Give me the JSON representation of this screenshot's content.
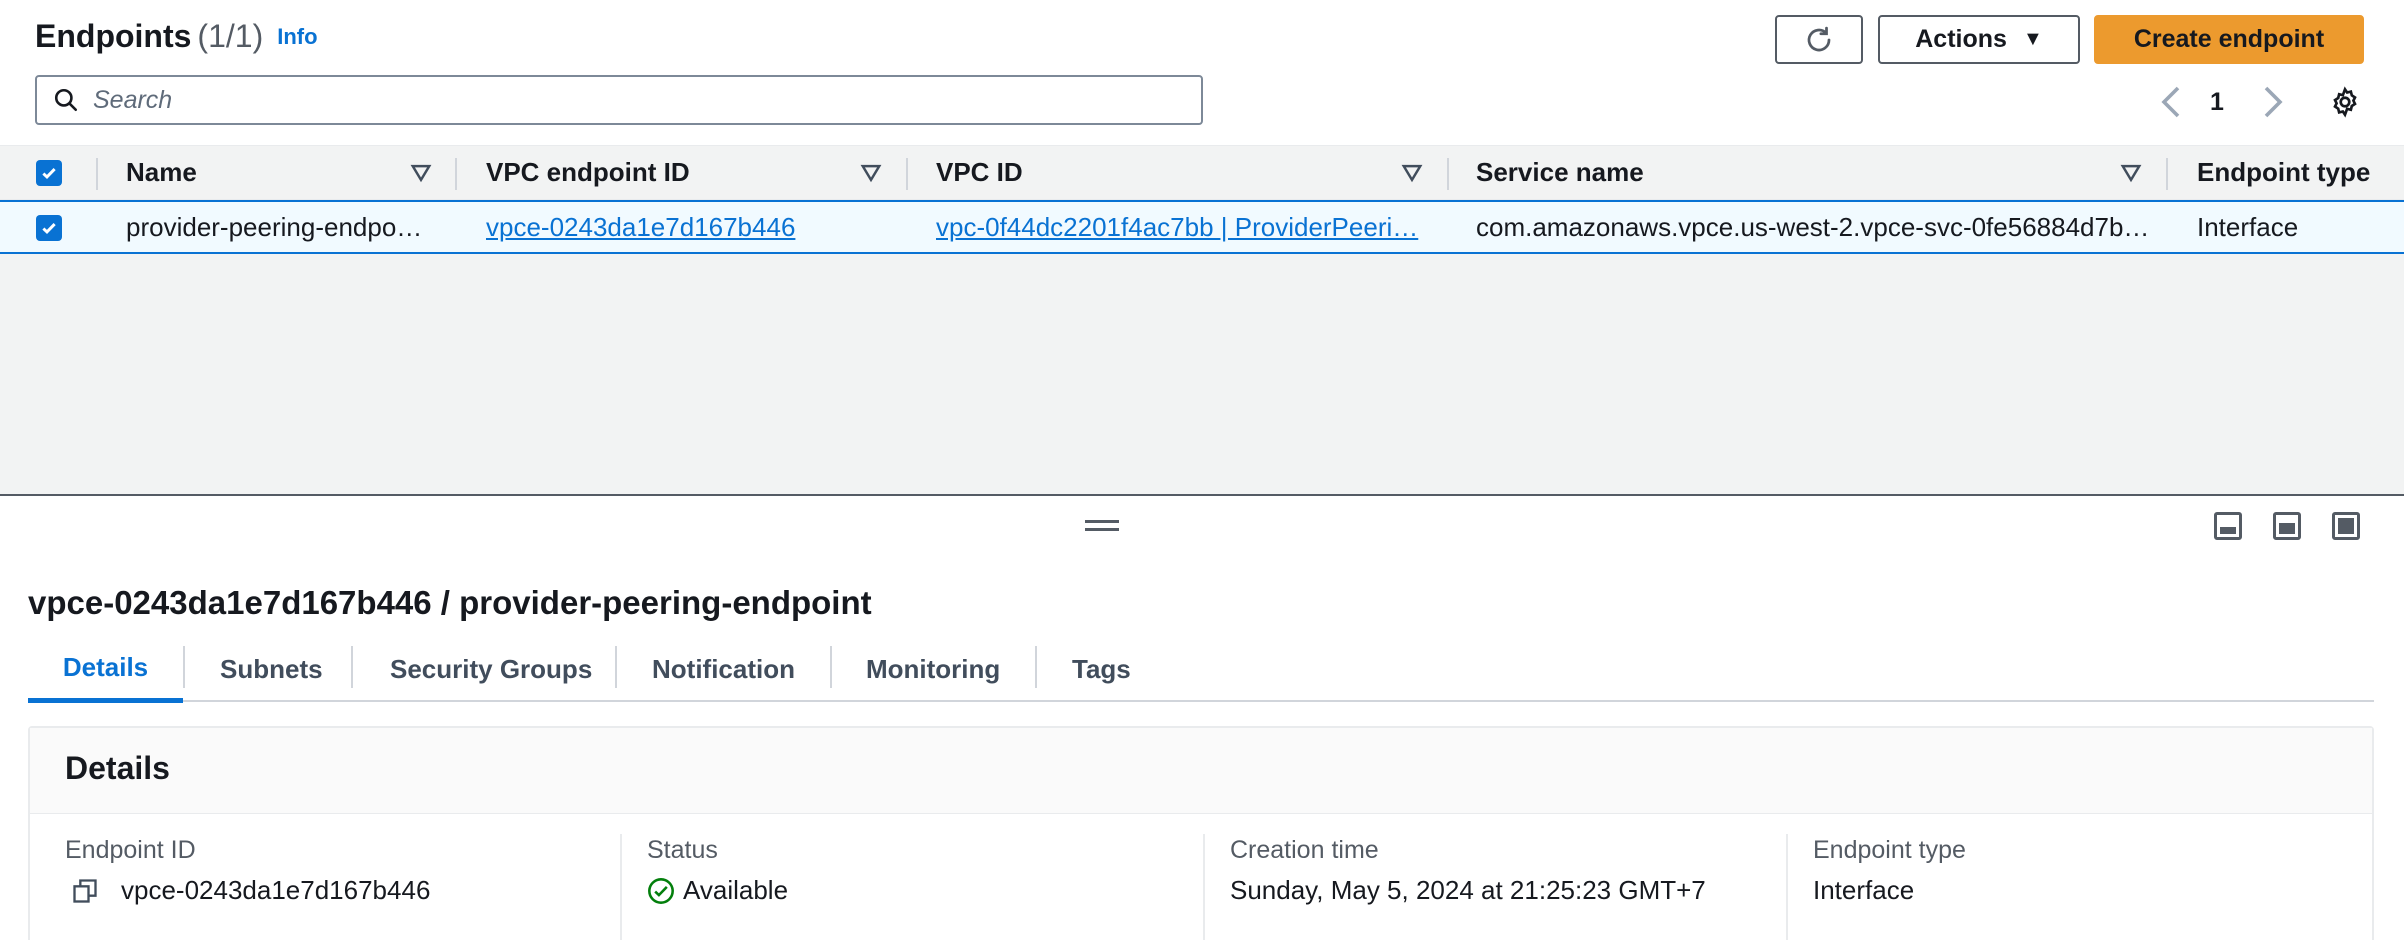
{
  "header": {
    "title": "Endpoints",
    "count": "(1/1)",
    "info": "Info",
    "actions_label": "Actions",
    "create_label": "Create endpoint"
  },
  "search": {
    "placeholder": "Search"
  },
  "pagination": {
    "current_page": "1"
  },
  "table": {
    "columns": [
      "Name",
      "VPC endpoint ID",
      "VPC ID",
      "Service name",
      "Endpoint type"
    ],
    "rows": [
      {
        "name": "provider-peering-endpo…",
        "vpc_endpoint_id": "vpce-0243da1e7d167b446",
        "vpc_id": "vpc-0f44dc2201f4ac7bb | ProviderPeeri…",
        "service_name": "com.amazonaws.vpce.us-west-2.vpce-svc-0fe56884d7b…",
        "endpoint_type": "Interface",
        "selected": true
      }
    ]
  },
  "detail": {
    "title": "vpce-0243da1e7d167b446 / provider-peering-endpoint",
    "tabs": [
      "Details",
      "Subnets",
      "Security Groups",
      "Notification",
      "Monitoring",
      "Tags"
    ],
    "active_tab": "Details",
    "section_title": "Details",
    "fields": [
      {
        "label": "Endpoint ID",
        "value": "vpce-0243da1e7d167b446"
      },
      {
        "label": "Status",
        "value": "Available"
      },
      {
        "label": "Creation time",
        "value": "Sunday, May 5, 2024 at 21:25:23 GMT+7"
      },
      {
        "label": "Endpoint type",
        "value": "Interface"
      }
    ]
  },
  "colors": {
    "primary": "#ec9a2e",
    "link": "#0972d3",
    "success": "#037f0c",
    "text": "#16191f"
  }
}
